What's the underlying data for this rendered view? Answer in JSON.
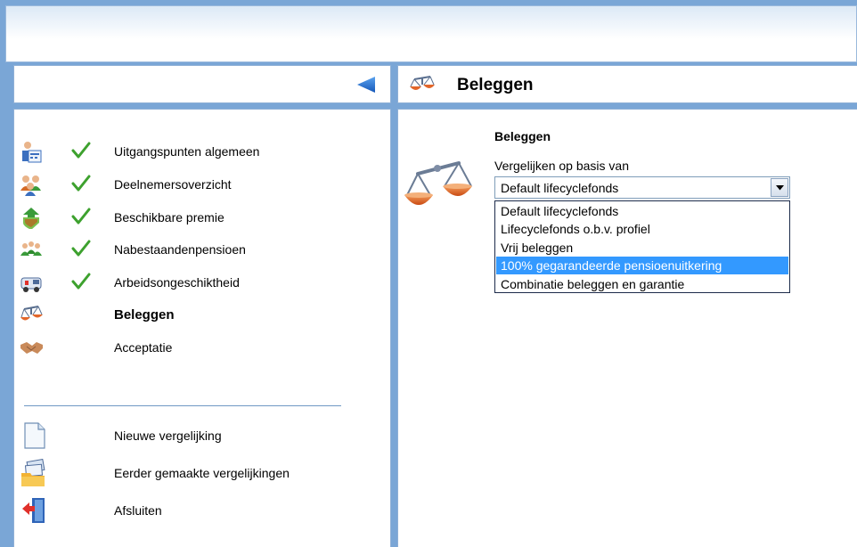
{
  "colors": {
    "window_bg": "#7aa6d6",
    "accent_blue": "#1f6fd1",
    "check_green": "#3da12e",
    "selected_option_bg": "#3399ff"
  },
  "sidebar": {
    "collapse_icon": "triangle-left-icon",
    "steps": [
      {
        "label": "Uitgangspunten algemeen",
        "icon": "person-calculator-icon",
        "completed": true
      },
      {
        "label": "Deelnemersoverzicht",
        "icon": "group-icon",
        "completed": true
      },
      {
        "label": "Beschikbare premie",
        "icon": "shield-arrow-icon",
        "completed": true
      },
      {
        "label": "Nabestaandenpensioen",
        "icon": "family-icon",
        "completed": true
      },
      {
        "label": "Arbeidsongeschiktheid",
        "icon": "ambulance-icon",
        "completed": true
      },
      {
        "label": "Beleggen",
        "icon": "scale-icon",
        "completed": false,
        "active": true
      },
      {
        "label": "Acceptatie",
        "icon": "handshake-icon",
        "completed": false
      }
    ],
    "actions": [
      {
        "label": "Nieuwe vergelijking",
        "icon": "new-document-icon"
      },
      {
        "label": "Eerder gemaakte vergelijkingen",
        "icon": "folder-stack-icon"
      },
      {
        "label": "Afsluiten",
        "icon": "exit-door-icon"
      }
    ]
  },
  "main": {
    "header_title": "Beleggen",
    "header_icon": "scale-icon",
    "section_title": "Beleggen",
    "compare_label": "Vergelijken op basis van",
    "select": {
      "value": "Default lifecyclefonds",
      "options": [
        "Default lifecyclefonds",
        "Lifecyclefonds o.b.v. profiel",
        "Vrij beleggen",
        "100% gegarandeerde pensioenuitkering",
        "Combinatie beleggen en garantie"
      ],
      "highlighted_option": "100% gegarandeerde pensioenuitkering"
    }
  }
}
